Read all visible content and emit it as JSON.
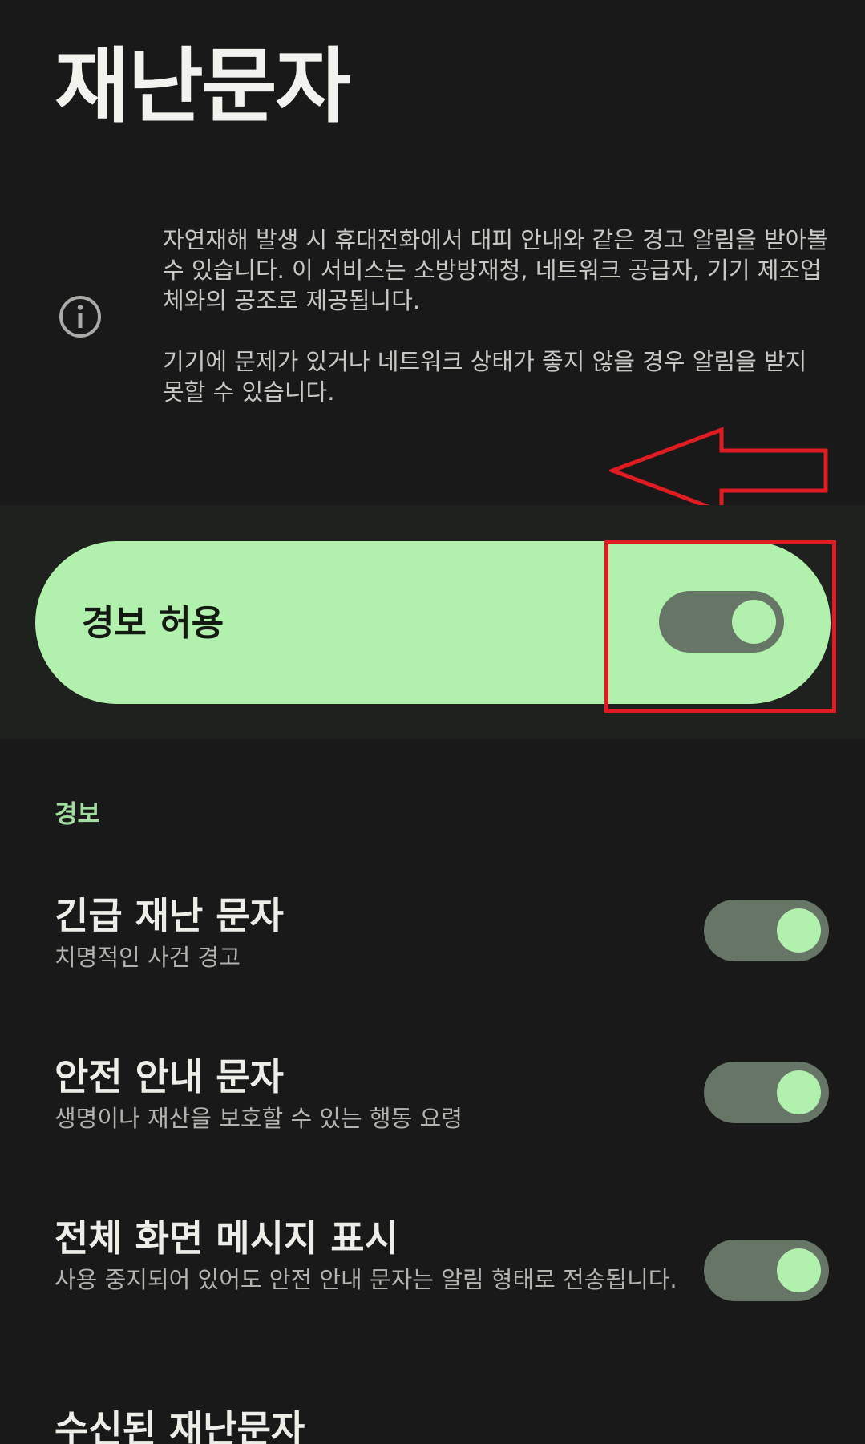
{
  "header": {
    "title": "재난문자"
  },
  "info": {
    "icon": "info-icon",
    "paragraph_1": "자연재해 발생 시 휴대전화에서 대피 안내와 같은 경고 알림을 받아볼 수 있습니다. 이 서비스는 소방방재청, 네트워크 공급자, 기기 제조업체와의 공조로 제공됩니다.",
    "paragraph_2": "기기에 문제가 있거나 네트워크 상태가 좋지 않을 경우 알림을 받지 못할 수 있습니다."
  },
  "master_switch": {
    "label": "경보 허용",
    "enabled": true
  },
  "annotation": {
    "arrow_color": "#e01b22",
    "highlight_color": "#e01b22"
  },
  "alerts_section": {
    "header": "경보",
    "items": [
      {
        "title": "긴급 재난 문자",
        "subtitle": "치명적인 사건 경고",
        "enabled": true
      },
      {
        "title": "안전 안내 문자",
        "subtitle": "생명이나 재산을 보호할 수 있는 행동 요령",
        "enabled": true
      },
      {
        "title": "전체 화면 메시지 표시",
        "subtitle": "사용 중지되어 있어도 안전 안내 문자는 알림 형태로 전송됩니다.",
        "enabled": true
      },
      {
        "title": "수신된 재난문자"
      }
    ]
  },
  "colors": {
    "background": "#191919",
    "accent": "#b2f0ad",
    "toggle_track": "#667566"
  }
}
